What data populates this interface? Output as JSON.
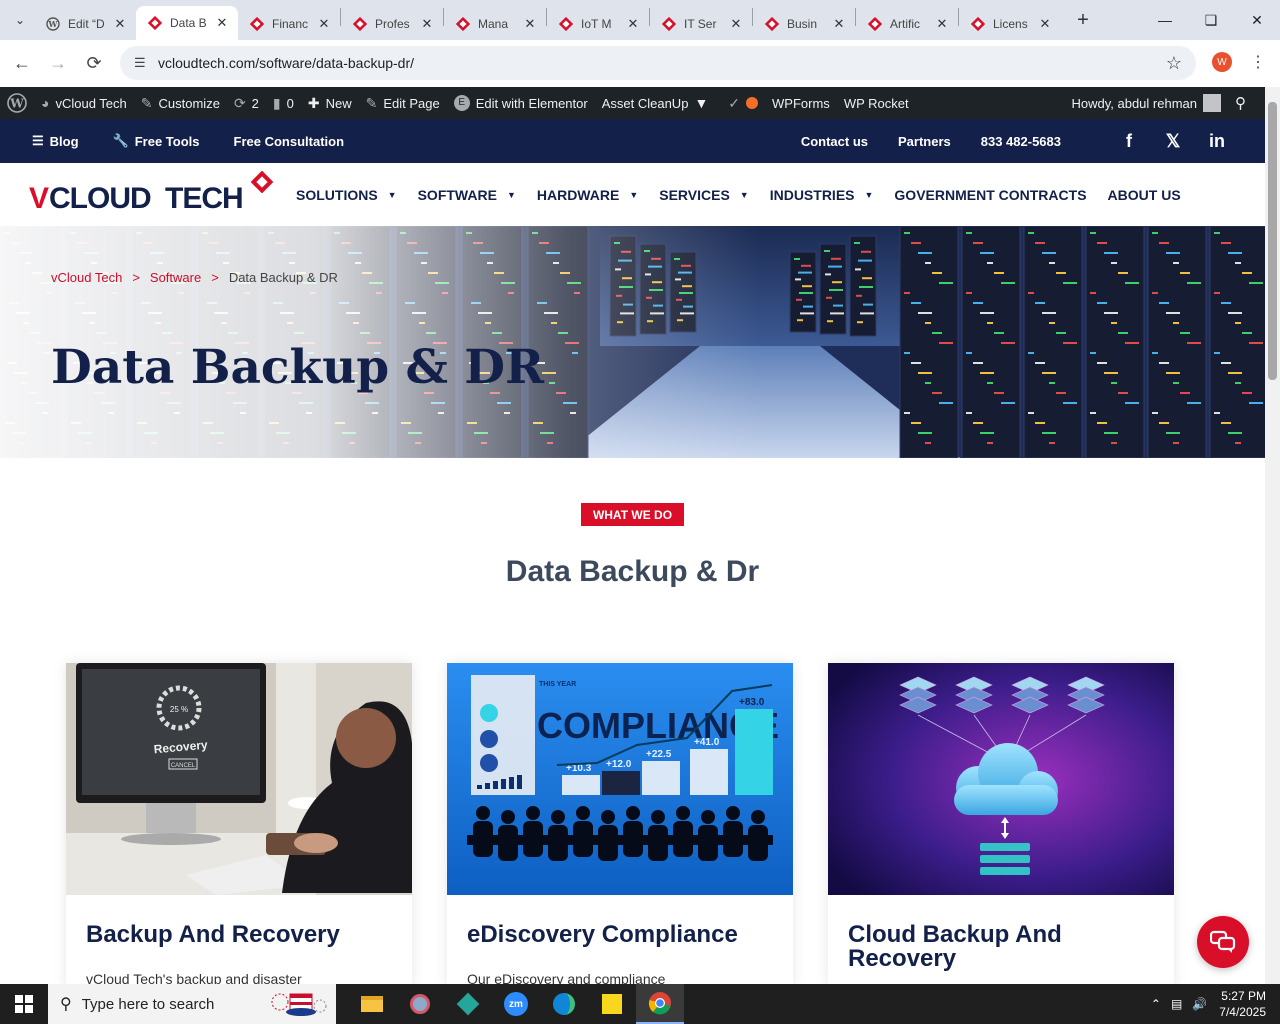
{
  "browser": {
    "tabs": [
      {
        "title": "Edit “D",
        "active": false,
        "icon": "wordpress-icon"
      },
      {
        "title": "Data B",
        "active": true,
        "icon": "vcloud-icon"
      },
      {
        "title": "Financ",
        "active": false,
        "icon": "vcloud-icon"
      },
      {
        "title": "Profes",
        "active": false,
        "icon": "vcloud-icon"
      },
      {
        "title": "Mana",
        "active": false,
        "icon": "vcloud-icon"
      },
      {
        "title": "IoT M",
        "active": false,
        "icon": "vcloud-icon"
      },
      {
        "title": "IT Ser",
        "active": false,
        "icon": "vcloud-icon"
      },
      {
        "title": "Busin",
        "active": false,
        "icon": "vcloud-icon"
      },
      {
        "title": "Artific",
        "active": false,
        "icon": "vcloud-icon"
      },
      {
        "title": "Licens",
        "active": false,
        "icon": "vcloud-icon"
      }
    ],
    "url": "vcloudtech.com/software/data-backup-dr/",
    "profile_initial": "W"
  },
  "wp_admin_bar": {
    "site_name": "vCloud Tech",
    "customize": "Customize",
    "updates_count": "2",
    "comments_count": "0",
    "new": "New",
    "edit_page": "Edit Page",
    "edit_elementor": "Edit with Elementor",
    "asset_cleanup": "Asset CleanUp",
    "wpforms": "WPForms",
    "wp_rocket": "WP Rocket",
    "howdy": "Howdy, abdul rehman"
  },
  "topbar": {
    "blog": "Blog",
    "free_tools": "Free Tools",
    "free_consultation": "Free Consultation",
    "contact": "Contact us",
    "partners": "Partners",
    "phone": "833 482-5683"
  },
  "site": {
    "logo_text": "VCLOUD TECH",
    "nav": [
      {
        "label": "SOLUTIONS",
        "dropdown": true
      },
      {
        "label": "SOFTWARE",
        "dropdown": true
      },
      {
        "label": "HARDWARE",
        "dropdown": true
      },
      {
        "label": "SERVICES",
        "dropdown": true
      },
      {
        "label": "INDUSTRIES",
        "dropdown": true
      },
      {
        "label": "GOVERNMENT CONTRACTS",
        "dropdown": false
      },
      {
        "label": "ABOUT US",
        "dropdown": false
      }
    ]
  },
  "hero": {
    "breadcrumb": [
      "vCloud Tech",
      "Software",
      "Data Backup & DR"
    ],
    "breadcrumb_sep": ">",
    "title": "Data Backup & DR"
  },
  "section": {
    "badge": "WHAT WE DO",
    "title": "Data Backup & Dr"
  },
  "cards": [
    {
      "title": "Backup And Recovery",
      "desc": "vCloud Tech's backup and disaster",
      "img_text": {
        "percent": "25 %",
        "label": "Recovery",
        "button": "CANCEL"
      }
    },
    {
      "title": "eDiscovery Compliance",
      "desc": "Our eDiscovery and compliance",
      "img_text": {
        "heading": "COMPLIANCE",
        "this_year": "THIS YEAR",
        "values": [
          "+10.3",
          "+12.0",
          "+22.5",
          "+41.0",
          "+83.0"
        ]
      }
    },
    {
      "title": "Cloud Backup And Recovery",
      "desc": ""
    }
  ],
  "taskbar": {
    "search_placeholder": "Type here to search",
    "time": "5:27 PM",
    "date": "7/4/2025"
  },
  "colors": {
    "brand_navy": "#13214a",
    "brand_red": "#d90f2a",
    "wp_bar": "#1d2327"
  }
}
